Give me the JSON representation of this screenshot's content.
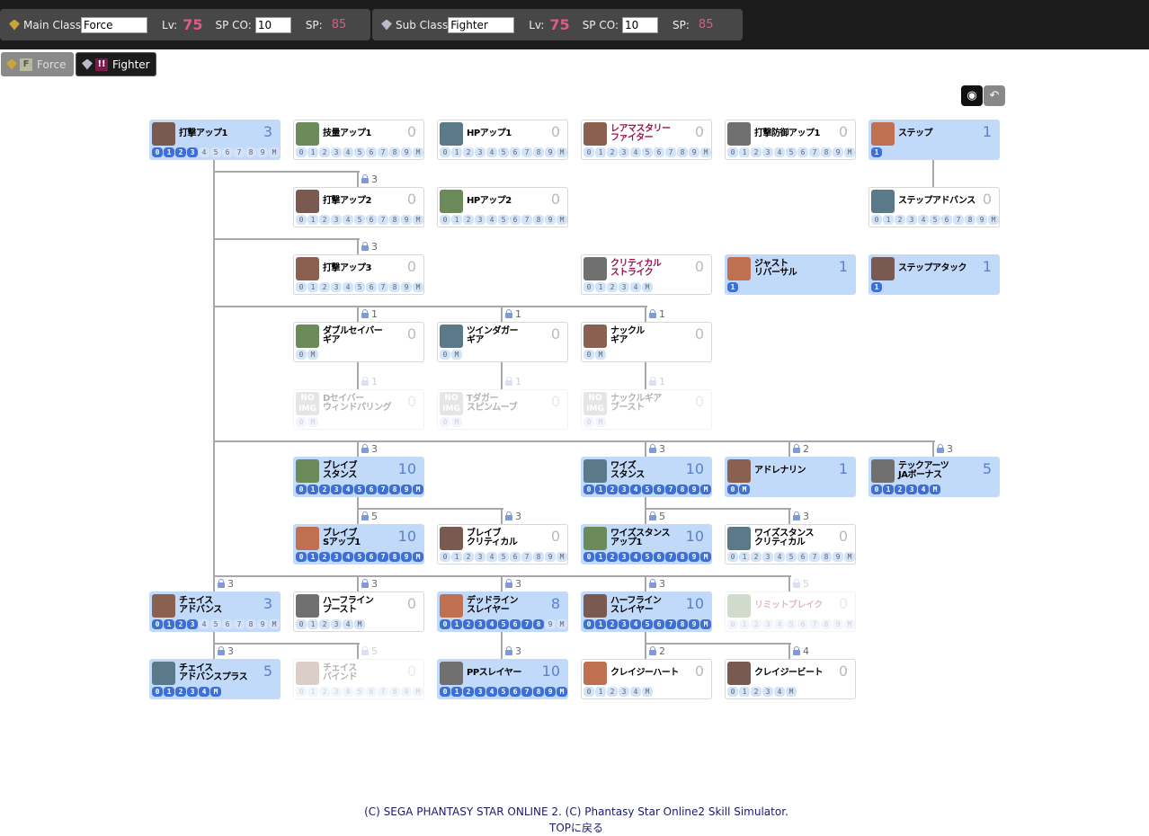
{
  "header": {
    "main": {
      "label": "Main Class",
      "value": "Force",
      "lv_label": "Lv:",
      "lv": "75",
      "spco_label": "SP CO:",
      "spco": "10",
      "sp_label": "SP:",
      "sp": "85"
    },
    "sub": {
      "label": "Sub  Class",
      "value": "Fighter",
      "lv_label": "Lv:",
      "lv": "75",
      "spco_label": "SP CO:",
      "spco": "10",
      "sp_label": "SP:",
      "sp": "85"
    }
  },
  "tabs": [
    {
      "label": "Force",
      "badge": "F",
      "active": false
    },
    {
      "label": "Fighter",
      "badge": "!!",
      "active": true
    }
  ],
  "tools": {
    "camera_icon": "camera-icon",
    "undo_icon": "undo-icon"
  },
  "colors": {
    "active_card": "#c2dafa",
    "pip_on": "#3d6fd6",
    "rare_text": "#a0104a",
    "level_text": "#e05a8a"
  },
  "skills": [
    {
      "name": "打撃アップ1",
      "level": "3",
      "pips": [
        "0",
        "1",
        "2",
        "3",
        "4",
        "5",
        "6",
        "7",
        "8",
        "9",
        "M"
      ],
      "on": 4,
      "state": "active"
    },
    {
      "name": "技量アップ1",
      "level": "0",
      "pips": [
        "0",
        "1",
        "2",
        "3",
        "4",
        "5",
        "6",
        "7",
        "8",
        "9",
        "M"
      ],
      "on": 0
    },
    {
      "name": "HPアップ1",
      "level": "0",
      "pips": [
        "0",
        "1",
        "2",
        "3",
        "4",
        "5",
        "6",
        "7",
        "8",
        "9",
        "M"
      ],
      "on": 0
    },
    {
      "name": "レアマスタリー\nファイター",
      "level": "0",
      "pips": [
        "0",
        "1",
        "2",
        "3",
        "4",
        "5",
        "6",
        "7",
        "8",
        "9",
        "M"
      ],
      "on": 0,
      "red": true
    },
    {
      "name": "打撃防御アップ1",
      "level": "0",
      "pips": [
        "0",
        "1",
        "2",
        "3",
        "4",
        "5",
        "6",
        "7",
        "8",
        "9",
        "M"
      ],
      "on": 0
    },
    {
      "name": "ステップ",
      "level": "1",
      "pips": [
        "1"
      ],
      "on": 1,
      "state": "active"
    },
    {
      "name": "打撃アップ2",
      "level": "0",
      "pips": [
        "0",
        "1",
        "2",
        "3",
        "4",
        "5",
        "6",
        "7",
        "8",
        "9",
        "M"
      ],
      "on": 0,
      "lock": "3"
    },
    {
      "name": "HPアップ2",
      "level": "0",
      "pips": [
        "0",
        "1",
        "2",
        "3",
        "4",
        "5",
        "6",
        "7",
        "8",
        "9",
        "M"
      ],
      "on": 0
    },
    {
      "name": "ステップアドバンス",
      "level": "0",
      "pips": [
        "0",
        "1",
        "2",
        "3",
        "4",
        "5",
        "6",
        "7",
        "8",
        "9",
        "M"
      ],
      "on": 0
    },
    {
      "name": "打撃アップ3",
      "level": "0",
      "pips": [
        "0",
        "1",
        "2",
        "3",
        "4",
        "5",
        "6",
        "7",
        "8",
        "9",
        "M"
      ],
      "on": 0,
      "lock": "3"
    },
    {
      "name": "クリティカル\nストライク",
      "level": "0",
      "pips": [
        "0",
        "1",
        "2",
        "3",
        "4",
        "M"
      ],
      "on": 0,
      "red": true
    },
    {
      "name": "ジャスト\nリバーサル",
      "level": "1",
      "pips": [
        "1"
      ],
      "on": 1,
      "state": "active"
    },
    {
      "name": "ステップアタック",
      "level": "1",
      "pips": [
        "1"
      ],
      "on": 1,
      "state": "active"
    },
    {
      "name": "ダブルセイバー\nギア",
      "level": "0",
      "pips": [
        "0",
        "M"
      ],
      "on": 0,
      "lock": "1"
    },
    {
      "name": "ツインダガー\nギア",
      "level": "0",
      "pips": [
        "0",
        "M"
      ],
      "on": 0,
      "lock": "1"
    },
    {
      "name": "ナックル\nギア",
      "level": "0",
      "pips": [
        "0",
        "M"
      ],
      "on": 0,
      "lock": "1"
    },
    {
      "name": "Dセイバー\nウィンドパリング",
      "level": "0",
      "pips": [
        "0",
        "M"
      ],
      "on": 0,
      "lock": "1",
      "state": "disabled",
      "noimg": "NO IMG"
    },
    {
      "name": "Tダガー\nスピンムーブ",
      "level": "0",
      "pips": [
        "0",
        "M"
      ],
      "on": 0,
      "lock": "1",
      "state": "disabled",
      "noimg": "NO IMG"
    },
    {
      "name": "ナックルギア\nブースト",
      "level": "0",
      "pips": [
        "0",
        "M"
      ],
      "on": 0,
      "lock": "1",
      "state": "disabled",
      "noimg": "NO IMG"
    },
    {
      "name": "ブレイブ\nスタンス",
      "level": "10",
      "pips": [
        "0",
        "1",
        "2",
        "3",
        "4",
        "5",
        "6",
        "7",
        "8",
        "9",
        "M"
      ],
      "on": 11,
      "lock": "3",
      "state": "active"
    },
    {
      "name": "ワイズ\nスタンス",
      "level": "10",
      "pips": [
        "0",
        "1",
        "2",
        "3",
        "4",
        "5",
        "6",
        "7",
        "8",
        "9",
        "M"
      ],
      "on": 11,
      "lock": "3",
      "state": "active"
    },
    {
      "name": "アドレナリン",
      "level": "1",
      "pips": [
        "0",
        "M"
      ],
      "on": 2,
      "lock": "2",
      "state": "active"
    },
    {
      "name": "テックアーツ\nJAボーナス",
      "level": "5",
      "pips": [
        "0",
        "1",
        "2",
        "3",
        "4",
        "M"
      ],
      "on": 6,
      "lock": "3",
      "state": "active"
    },
    {
      "name": "ブレイブ\nSアップ1",
      "level": "10",
      "pips": [
        "0",
        "1",
        "2",
        "3",
        "4",
        "5",
        "6",
        "7",
        "8",
        "9",
        "M"
      ],
      "on": 11,
      "lock": "5",
      "state": "active"
    },
    {
      "name": "ブレイブ\nクリティカル",
      "level": "0",
      "pips": [
        "0",
        "1",
        "2",
        "3",
        "4",
        "5",
        "6",
        "7",
        "8",
        "9",
        "M"
      ],
      "on": 0,
      "lock": "3"
    },
    {
      "name": "ワイズスタンス\nアップ1",
      "level": "10",
      "pips": [
        "0",
        "1",
        "2",
        "3",
        "4",
        "5",
        "6",
        "7",
        "8",
        "9",
        "M"
      ],
      "on": 11,
      "lock": "5",
      "state": "active"
    },
    {
      "name": "ワイズスタンス\nクリティカル",
      "level": "0",
      "pips": [
        "0",
        "1",
        "2",
        "3",
        "4",
        "5",
        "6",
        "7",
        "8",
        "9",
        "M"
      ],
      "on": 0,
      "lock": "3"
    },
    {
      "name": "チェイス\nアドバンス",
      "level": "3",
      "pips": [
        "0",
        "1",
        "2",
        "3",
        "4",
        "5",
        "6",
        "7",
        "8",
        "9",
        "M"
      ],
      "on": 4,
      "lock": "3",
      "state": "active"
    },
    {
      "name": "ハーフライン\nブースト",
      "level": "0",
      "pips": [
        "0",
        "1",
        "2",
        "3",
        "4",
        "M"
      ],
      "on": 0,
      "lock": "3"
    },
    {
      "name": "デッドライン\nスレイヤー",
      "level": "8",
      "pips": [
        "0",
        "1",
        "2",
        "3",
        "4",
        "5",
        "6",
        "7",
        "8",
        "9",
        "M"
      ],
      "on": 9,
      "lock": "3",
      "state": "active"
    },
    {
      "name": "ハーフライン\nスレイヤー",
      "level": "10",
      "pips": [
        "0",
        "1",
        "2",
        "3",
        "4",
        "5",
        "6",
        "7",
        "8",
        "9",
        "M"
      ],
      "on": 11,
      "lock": "3",
      "state": "active"
    },
    {
      "name": "リミットブレイク",
      "level": "0",
      "pips": [
        "0",
        "1",
        "2",
        "3",
        "4",
        "5",
        "6",
        "7",
        "8",
        "9",
        "M"
      ],
      "on": 0,
      "lock": "5",
      "state": "disabled",
      "red": true
    },
    {
      "name": "チェイス\nアドバンスプラス",
      "level": "5",
      "pips": [
        "0",
        "1",
        "2",
        "3",
        "4",
        "M"
      ],
      "on": 6,
      "lock": "3",
      "state": "active"
    },
    {
      "name": "チェイス\nバインド",
      "level": "0",
      "pips": [
        "0",
        "1",
        "2",
        "3",
        "4",
        "5",
        "6",
        "7",
        "8",
        "9",
        "M"
      ],
      "on": 0,
      "lock": "5",
      "state": "disabled"
    },
    {
      "name": "PPスレイヤー",
      "level": "10",
      "pips": [
        "0",
        "1",
        "2",
        "3",
        "4",
        "5",
        "6",
        "7",
        "8",
        "9",
        "M"
      ],
      "on": 11,
      "lock": "3",
      "state": "active"
    },
    {
      "name": "クレイジーハート",
      "level": "0",
      "pips": [
        "0",
        "1",
        "2",
        "3",
        "4",
        "M"
      ],
      "on": 0,
      "lock": "2"
    },
    {
      "name": "クレイジービート",
      "level": "0",
      "pips": [
        "0",
        "1",
        "2",
        "3",
        "4",
        "M"
      ],
      "on": 0,
      "lock": "4"
    }
  ],
  "footer": {
    "copyright": "(C)  SEGA   PHANTASY STAR ONLINE 2.  (C)  Phantasy Star Online2 Skill Simulator.",
    "top_link": "TOPに戻る"
  }
}
